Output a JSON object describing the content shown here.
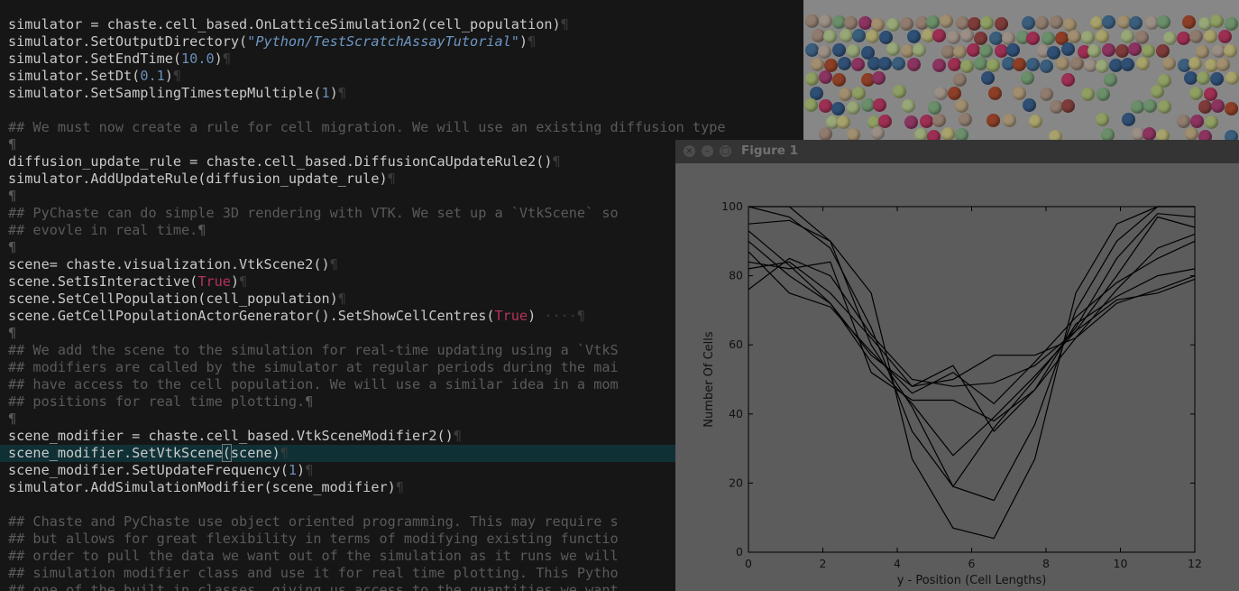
{
  "editor": {
    "lines": [
      {
        "type": "code",
        "segments": [
          {
            "t": "simulator = chaste.cell_based.OnLatticeSimulation2(cell_population)"
          },
          {
            "t": "¶",
            "c": "ws"
          }
        ]
      },
      {
        "type": "code",
        "segments": [
          {
            "t": "simulator.SetOutputDirectory("
          },
          {
            "t": "\"Python/TestScratchAssayTutorial\"",
            "c": "str"
          },
          {
            "t": ")"
          },
          {
            "t": "¶",
            "c": "ws"
          }
        ]
      },
      {
        "type": "code",
        "segments": [
          {
            "t": "simulator.SetEndTime("
          },
          {
            "t": "10.0",
            "c": "num"
          },
          {
            "t": ")"
          },
          {
            "t": "¶",
            "c": "ws"
          }
        ]
      },
      {
        "type": "code",
        "segments": [
          {
            "t": "simulator.SetDt("
          },
          {
            "t": "0.1",
            "c": "num"
          },
          {
            "t": ")"
          },
          {
            "t": "¶",
            "c": "ws"
          }
        ]
      },
      {
        "type": "code",
        "segments": [
          {
            "t": "simulator.SetSamplingTimestepMultiple("
          },
          {
            "t": "1",
            "c": "num"
          },
          {
            "t": ")"
          },
          {
            "t": "¶",
            "c": "ws"
          }
        ]
      },
      {
        "type": "blank",
        "segments": []
      },
      {
        "type": "comment",
        "segments": [
          {
            "t": "## We must now create a rule for cell migration. We will use an existing diffusion type"
          }
        ]
      },
      {
        "type": "comment",
        "segments": [
          {
            "t": "¶"
          }
        ]
      },
      {
        "type": "code",
        "segments": [
          {
            "t": "diffusion_update_rule = chaste.cell_based.DiffusionCaUpdateRule2()"
          },
          {
            "t": "¶",
            "c": "ws"
          }
        ]
      },
      {
        "type": "code",
        "segments": [
          {
            "t": "simulator.AddUpdateRule(diffusion_update_rule)"
          },
          {
            "t": "¶",
            "c": "ws"
          }
        ]
      },
      {
        "type": "comment",
        "segments": [
          {
            "t": "¶"
          }
        ]
      },
      {
        "type": "comment",
        "segments": [
          {
            "t": "## PyChaste can do simple 3D rendering with VTK. We set up a `VtkScene` so"
          }
        ]
      },
      {
        "type": "comment",
        "segments": [
          {
            "t": "## evovle in real time.¶"
          }
        ]
      },
      {
        "type": "comment",
        "segments": [
          {
            "t": "¶"
          }
        ]
      },
      {
        "type": "code",
        "segments": [
          {
            "t": "scene= chaste.visualization.VtkScene2()"
          },
          {
            "t": "¶",
            "c": "ws"
          }
        ]
      },
      {
        "type": "code",
        "segments": [
          {
            "t": "scene.SetIsInteractive("
          },
          {
            "t": "True",
            "c": "kw"
          },
          {
            "t": ")"
          },
          {
            "t": "¶",
            "c": "ws"
          }
        ]
      },
      {
        "type": "code",
        "segments": [
          {
            "t": "scene.SetCellPopulation(cell_population)"
          },
          {
            "t": "¶",
            "c": "ws"
          }
        ]
      },
      {
        "type": "code",
        "segments": [
          {
            "t": "scene.GetCellPopulationActorGenerator().SetShowCellCentres("
          },
          {
            "t": "True",
            "c": "kw"
          },
          {
            "t": ")"
          },
          {
            "t": " ····¶",
            "c": "ws"
          }
        ]
      },
      {
        "type": "comment",
        "segments": [
          {
            "t": "¶"
          }
        ]
      },
      {
        "type": "comment",
        "segments": [
          {
            "t": "## We add the scene to the simulation for real-time updating using a `VtkS"
          }
        ]
      },
      {
        "type": "comment",
        "segments": [
          {
            "t": "## modifiers are called by the simulator at regular periods during the mai"
          }
        ]
      },
      {
        "type": "comment",
        "segments": [
          {
            "t": "## have access to the cell population. We will use a similar idea in a mom"
          }
        ]
      },
      {
        "type": "comment",
        "segments": [
          {
            "t": "## positions for real time plotting.¶"
          }
        ]
      },
      {
        "type": "comment",
        "segments": [
          {
            "t": "¶"
          }
        ]
      },
      {
        "type": "code",
        "segments": [
          {
            "t": "scene_modifier = chaste.cell_based.VtkSceneModifier2()"
          },
          {
            "t": "¶",
            "c": "ws"
          }
        ]
      },
      {
        "type": "code",
        "highlight": true,
        "segments": [
          {
            "t": "scene_modifier.SetVtkScene"
          },
          {
            "t": "(",
            "c": "cur"
          },
          {
            "t": "scene)"
          },
          {
            "t": "¶",
            "c": "ws"
          }
        ]
      },
      {
        "type": "code",
        "segments": [
          {
            "t": "scene_modifier.SetUpdateFrequency("
          },
          {
            "t": "1",
            "c": "num"
          },
          {
            "t": ")"
          },
          {
            "t": "¶",
            "c": "ws"
          }
        ]
      },
      {
        "type": "code",
        "segments": [
          {
            "t": "simulator.AddSimulationModifier(scene_modifier)"
          },
          {
            "t": "¶",
            "c": "ws"
          }
        ]
      },
      {
        "type": "blank",
        "segments": []
      },
      {
        "type": "comment",
        "segments": [
          {
            "t": "## Chaste and PyChaste use object oriented programming. This may require s"
          }
        ]
      },
      {
        "type": "comment",
        "segments": [
          {
            "t": "## but allows for great flexibility in terms of modifying existing functio"
          }
        ]
      },
      {
        "type": "comment",
        "segments": [
          {
            "t": "## order to pull the data we want out of the simulation as it runs we will"
          }
        ]
      },
      {
        "type": "comment",
        "segments": [
          {
            "t": "## simulation modifier class and use it for real time plotting. This Pytho"
          }
        ]
      },
      {
        "type": "comment",
        "segments": [
          {
            "t": "## one of the built in classes, giving us access to the quantities we want"
          }
        ]
      }
    ]
  },
  "figure_window": {
    "title": "Figure 1",
    "buttons": [
      {
        "name": "close-icon",
        "glyph": "×"
      },
      {
        "name": "minimize-icon",
        "glyph": "–"
      },
      {
        "name": "maximize-icon",
        "glyph": "□"
      }
    ]
  },
  "chart_data": {
    "type": "line",
    "xlabel": "y - Position (Cell Lengths)",
    "ylabel": "Number Of Cells",
    "xlim": [
      0,
      12
    ],
    "ylim": [
      0,
      100
    ],
    "xticks": [
      0,
      2,
      4,
      6,
      8,
      10,
      12
    ],
    "yticks": [
      0,
      20,
      40,
      60,
      80,
      100
    ],
    "grid": false,
    "x": [
      0,
      1.1,
      2.2,
      3.3,
      4.4,
      5.5,
      6.6,
      7.7,
      8.8,
      9.9,
      11,
      12
    ],
    "series": [
      {
        "values": [
          100,
          100,
          90,
          75,
          27,
          7,
          4,
          27,
          75,
          95,
          100,
          100
        ]
      },
      {
        "values": [
          100,
          97,
          88,
          65,
          35,
          19,
          15,
          37,
          70,
          90,
          100,
          100
        ]
      },
      {
        "values": [
          95,
          96,
          90,
          60,
          42,
          19,
          36,
          50,
          65,
          85,
          98,
          97
        ]
      },
      {
        "values": [
          93,
          83,
          72,
          55,
          43,
          28,
          39,
          51,
          64,
          80,
          97,
          94
        ]
      },
      {
        "values": [
          90,
          80,
          72,
          57,
          48,
          54,
          35,
          47,
          62,
          76,
          88,
          92
        ]
      },
      {
        "values": [
          87,
          75,
          71,
          58,
          46,
          52,
          43,
          55,
          68,
          78,
          85,
          90
        ]
      },
      {
        "values": [
          84,
          82,
          84,
          52,
          44,
          44,
          38,
          47,
          66,
          74,
          80,
          82
        ]
      },
      {
        "values": [
          82,
          84,
          75,
          62,
          48,
          50,
          57,
          57,
          62,
          72,
          76,
          80
        ]
      },
      {
        "values": [
          76,
          85,
          80,
          63,
          50,
          48,
          49,
          54,
          64,
          73,
          75,
          79
        ]
      }
    ],
    "colors": {
      "line": "#000000",
      "plot_bg": "#5c5c5c",
      "frame": "#000000"
    }
  },
  "vtk_scene": {
    "background": "#878787",
    "cell_colors": [
      "#a7a16b",
      "#8f9f63",
      "#97a777",
      "#8f7c6e",
      "#2f4f74",
      "#3b5e7d",
      "#8b3460",
      "#9c2f52",
      "#7d3c3a",
      "#8c3f26",
      "#6b8f6a",
      "#9b8f85",
      "#a08e6f"
    ]
  }
}
